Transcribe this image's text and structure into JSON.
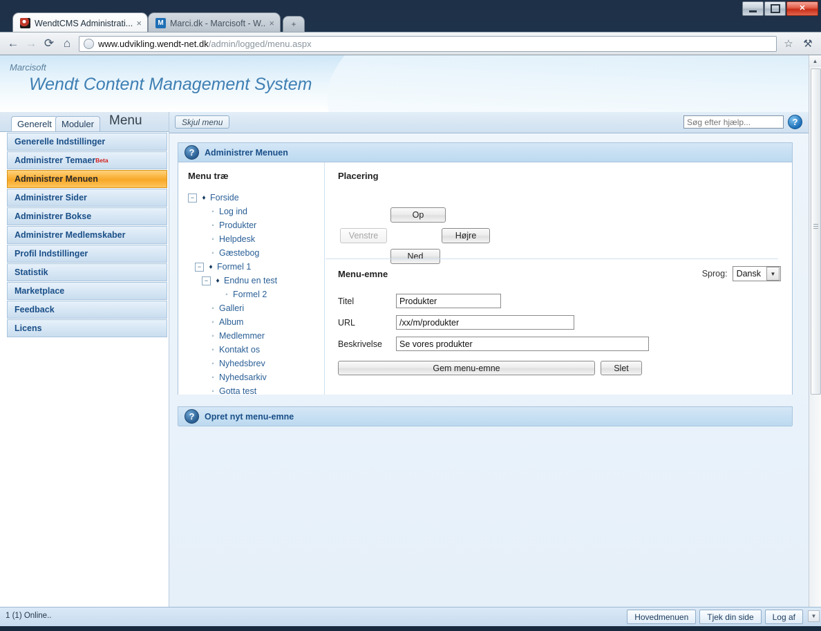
{
  "browser": {
    "tabs": [
      {
        "title": "WendtCMS Administrati...",
        "favicon": "w-logo-icon",
        "active": true
      },
      {
        "title": "Marci.dk - Marcisoft - W...",
        "favicon": "m-logo-icon",
        "active": false
      }
    ],
    "new_tab_label": "+",
    "close_glyph": "×",
    "nav": {
      "back": "←",
      "forward": "→",
      "reload": "⟳",
      "home": "⌂",
      "star": "☆",
      "wrench": "⚒"
    },
    "url_host": "www.udvikling.wendt-net.dk",
    "url_path": "/admin/logged/menu.aspx",
    "window": {
      "minimize": "",
      "maximize": "",
      "close": "✕"
    }
  },
  "banner": {
    "brand_small": "Marcisoft",
    "brand_big": "Wendt Content Management System"
  },
  "sidebar": {
    "tabs": [
      {
        "label": "Generelt",
        "active": true
      },
      {
        "label": "Moduler",
        "active": false
      }
    ],
    "heading": "Menu",
    "items": [
      {
        "label": "Generelle Indstillinger",
        "active": false
      },
      {
        "label": "Administrer Temaer",
        "badge": "Beta",
        "active": false
      },
      {
        "label": "Administrer Menuen",
        "active": true
      },
      {
        "label": "Administrer Sider",
        "active": false
      },
      {
        "label": "Administrer Bokse",
        "active": false
      },
      {
        "label": "Administrer Medlemskaber",
        "active": false
      },
      {
        "label": "Profil Indstillinger",
        "active": false
      },
      {
        "label": "Statistik",
        "active": false
      },
      {
        "label": "Marketplace",
        "active": false
      },
      {
        "label": "Feedback",
        "active": false
      },
      {
        "label": "Licens",
        "active": false
      }
    ]
  },
  "toolbar": {
    "hide_menu_label": "Skjul menu",
    "search_placeholder": "Søg efter hjælp...",
    "search_value": "",
    "help_icon": "question-mark-icon"
  },
  "panels": {
    "main_title": "Administrer Menuen",
    "create_title": "Opret nyt menu-emne"
  },
  "tree": {
    "title": "Menu træ",
    "toggle_expanded": "−",
    "bullet_filled": "♦",
    "bullet_hollow": "◦",
    "nodes": [
      {
        "label": "Forside",
        "depth": 0,
        "toggle": true,
        "bullet": "filled"
      },
      {
        "label": "Log ind",
        "depth": 1,
        "toggle": false,
        "bullet": "hollow"
      },
      {
        "label": "Produkter",
        "depth": 1,
        "toggle": false,
        "bullet": "hollow"
      },
      {
        "label": "Helpdesk",
        "depth": 1,
        "toggle": false,
        "bullet": "hollow"
      },
      {
        "label": "Gæstebog",
        "depth": 1,
        "toggle": false,
        "bullet": "hollow"
      },
      {
        "label": "Formel 1",
        "depth": 1,
        "toggle": true,
        "bullet": "filled"
      },
      {
        "label": "Endnu en test",
        "depth": 2,
        "toggle": true,
        "bullet": "filled"
      },
      {
        "label": "Formel 2",
        "depth": 3,
        "toggle": false,
        "bullet": "hollow"
      },
      {
        "label": "Galleri",
        "depth": 1,
        "toggle": false,
        "bullet": "hollow"
      },
      {
        "label": "Album",
        "depth": 1,
        "toggle": false,
        "bullet": "hollow"
      },
      {
        "label": "Medlemmer",
        "depth": 1,
        "toggle": false,
        "bullet": "hollow"
      },
      {
        "label": "Kontakt os",
        "depth": 1,
        "toggle": false,
        "bullet": "hollow"
      },
      {
        "label": "Nyhedsbrev",
        "depth": 1,
        "toggle": false,
        "bullet": "hollow"
      },
      {
        "label": "Nyhedsarkiv",
        "depth": 1,
        "toggle": false,
        "bullet": "hollow"
      },
      {
        "label": "Gotta test",
        "depth": 1,
        "toggle": false,
        "bullet": "hollow"
      }
    ]
  },
  "placement": {
    "title": "Placering",
    "up": "Op",
    "left": "Venstre",
    "right": "Højre",
    "down": "Ned",
    "left_disabled": true
  },
  "menu_item_form": {
    "title": "Menu-emne",
    "language_label": "Sprog:",
    "language_value": "Dansk",
    "language_options": [
      "Dansk"
    ],
    "fields": [
      {
        "label": "Titel",
        "value": "Produkter"
      },
      {
        "label": "URL",
        "value": "/xx/m/produkter"
      },
      {
        "label": "Beskrivelse",
        "value": "Se vores produkter"
      }
    ],
    "save_label": "Gem menu-emne",
    "delete_label": "Slet"
  },
  "statusbar": {
    "online_text": "1 (1) Online..",
    "buttons": [
      "Hovedmenuen",
      "Tjek din side",
      "Log af"
    ]
  },
  "colors": {
    "accent_orange": "#f7a827",
    "link_blue": "#1a4f88",
    "beta_red": "#d11a1a"
  }
}
